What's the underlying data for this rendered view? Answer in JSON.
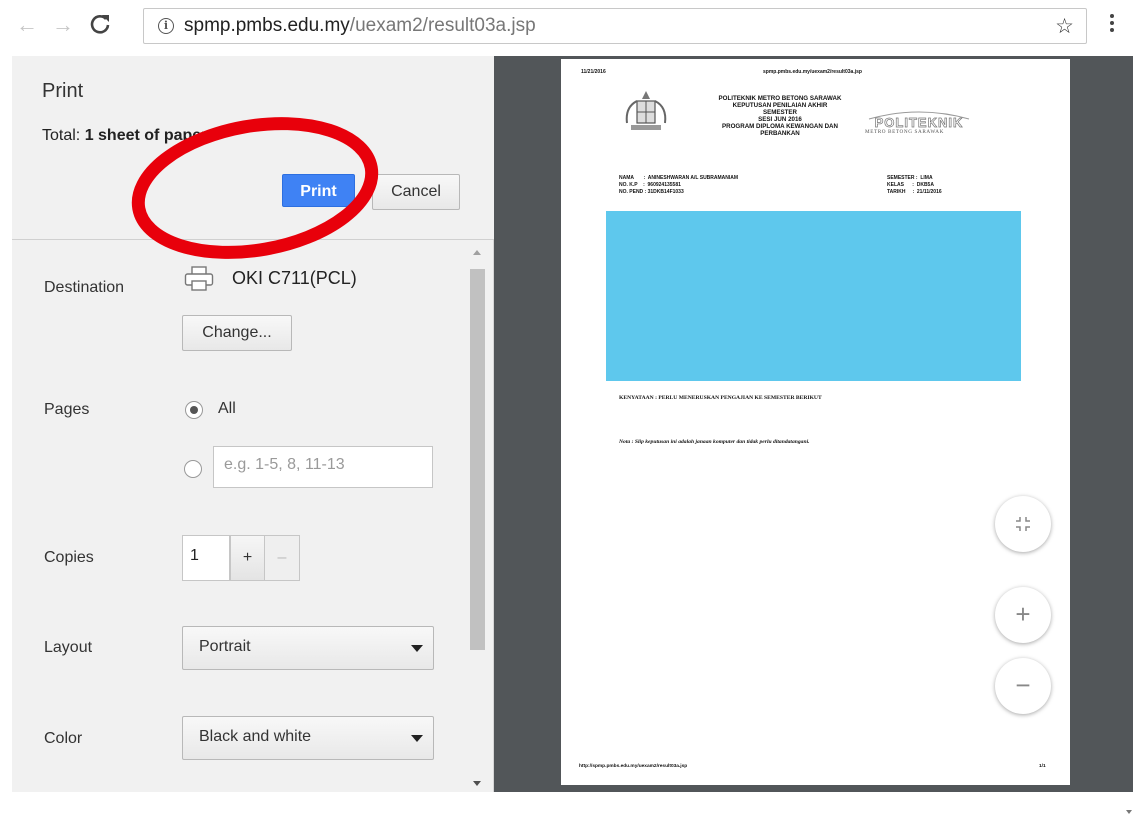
{
  "browser": {
    "url_host": "spmp.pmbs.edu.my",
    "url_path": "/uexam2/result03a.jsp"
  },
  "print_dialog": {
    "title": "Print",
    "total_prefix": "Total: ",
    "total_value": "1 sheet of paper",
    "print_button": "Print",
    "cancel_button": "Cancel",
    "destination_label": "Destination",
    "destination_value": "OKI C711(PCL)",
    "change_button": "Change...",
    "pages_label": "Pages",
    "pages_all": "All",
    "pages_placeholder": "e.g. 1-5, 8, 11-13",
    "copies_label": "Copies",
    "copies_value": "1",
    "copies_plus": "+",
    "copies_minus": "–",
    "layout_label": "Layout",
    "layout_value": "Portrait",
    "color_label": "Color",
    "color_value": "Black and white"
  },
  "preview_page": {
    "date": "11/21/2016",
    "header_url": "spmp.pmbs.edu.my/uexam2/result03a.jsp",
    "institution": "POLITEKNIK METRO BETONG SARAWAK\nKEPUTUSAN PENILAIAN AKHIR\nSEMESTER\nSESI JUN 2016\nPROGRAM DIPLOMA KEWANGAN DAN\nPERBANKAN",
    "logo_text": "POLITEKNIK",
    "logo_subtext": "METRO BETONG SARAWAK",
    "student_left": "NAMA       :  ANINESHWARAN A/L SUBRAMANIAM\nNO. K.P    :  960924135581\nNO. PEND : 31DKB14F1033",
    "student_right": "SEMESTER :  LIMA\nKELAS      :  DKB5A\nTARIKH     :  21/11/2016",
    "statement": "KENYATAAN : PERLU MENERUSKAN PENGAJIAN KE SEMESTER BERIKUT",
    "note": "Nota : Slip keputusan ini adalah janaan komputer dan tidak perlu ditandatangani.",
    "footer_url": "http://spmp.pmbs.edu.my/uexam2/result03a.jsp",
    "footer_page": "1/1"
  },
  "zoom": {
    "plus": "+",
    "minus": "−"
  },
  "colors": {
    "print_button": "#3f82f4",
    "annotation_circle": "#e8000b",
    "results_box": "#5ec8ed",
    "preview_bg": "#525659"
  }
}
